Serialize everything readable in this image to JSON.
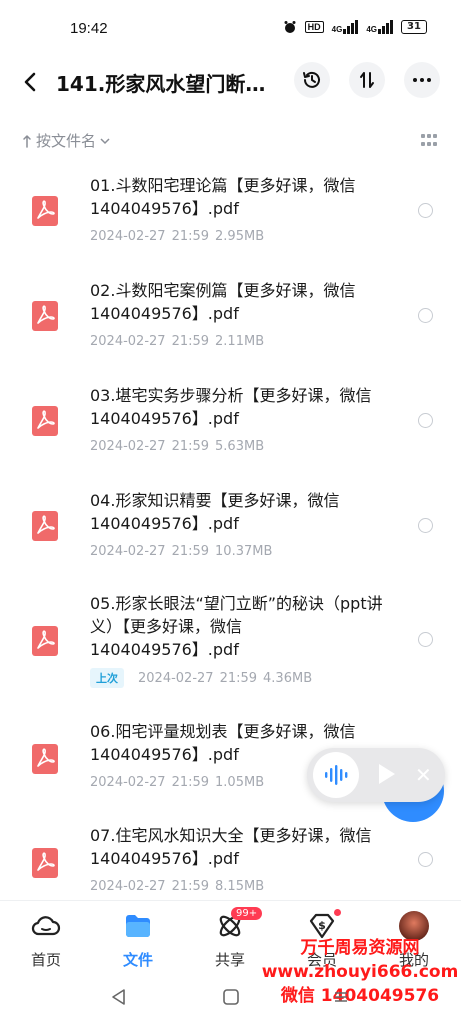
{
  "status": {
    "time": "19:42",
    "hd": "HD",
    "signal1": "4G",
    "signal2": "4G",
    "battery": "31"
  },
  "header": {
    "title": "141.形家风水望门断…"
  },
  "sort": {
    "label": "按文件名"
  },
  "files": [
    {
      "name": "01.斗数阳宅理论篇【更多好课，微信1404049576】.pdf",
      "date": "2024-02-27",
      "time": "21:59",
      "size": "2.95MB",
      "badge": ""
    },
    {
      "name": "02.斗数阳宅案例篇【更多好课，微信1404049576】.pdf",
      "date": "2024-02-27",
      "time": "21:59",
      "size": "2.11MB",
      "badge": ""
    },
    {
      "name": "03.堪宅实务步骤分析【更多好课，微信1404049576】.pdf",
      "date": "2024-02-27",
      "time": "21:59",
      "size": "5.63MB",
      "badge": ""
    },
    {
      "name": "04.形家知识精要【更多好课，微信1404049576】.pdf",
      "date": "2024-02-27",
      "time": "21:59",
      "size": "10.37MB",
      "badge": ""
    },
    {
      "name": "05.形家长眼法“望门立断”的秘诀（ppt讲义）【更多好课，微信1404049576】.pdf",
      "date": "2024-02-27",
      "time": "21:59",
      "size": "4.36MB",
      "badge": "上次"
    },
    {
      "name": "06.阳宅评量规划表【更多好课，微信1404049576】.pdf",
      "date": "2024-02-27",
      "time": "21:59",
      "size": "1.05MB",
      "badge": ""
    },
    {
      "name": "07.住宅风水知识大全【更多好课，微信1404049576】.pdf",
      "date": "2024-02-27",
      "time": "21:59",
      "size": "8.15MB",
      "badge": ""
    }
  ],
  "nav": [
    {
      "label": "首页",
      "icon": "cloud-icon"
    },
    {
      "label": "文件",
      "icon": "folder-icon"
    },
    {
      "label": "共享",
      "icon": "share-icon",
      "badge": "99+"
    },
    {
      "label": "会员",
      "icon": "vip-icon"
    },
    {
      "label": "我的",
      "icon": "avatar"
    }
  ],
  "watermark": {
    "line1": "万千周易资源网",
    "line2": "www.zhouyi666.com",
    "line3": "微信 1404049576"
  },
  "colors": {
    "accent": "#2f8cff",
    "pdf": "#f06a6a",
    "watermark": "#ff1a1a"
  }
}
